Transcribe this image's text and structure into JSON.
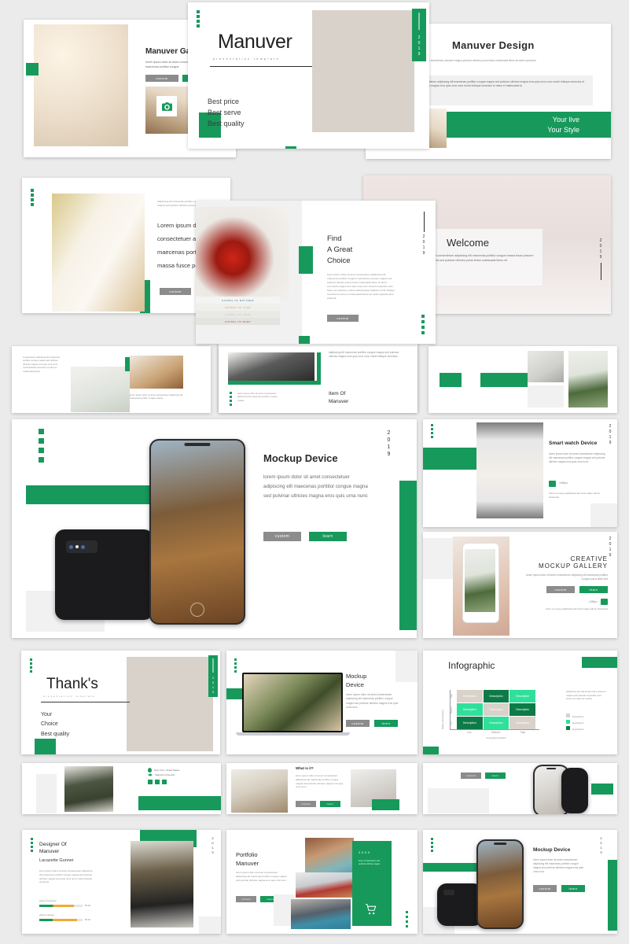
{
  "theme": {
    "accent": "#17995c",
    "accent_light": "#2fe09a",
    "accent_dark": "#0d7b47",
    "beige": "#d8d2ca",
    "gray_btn": "#8c8c8c",
    "page_bg": "#ebebeb"
  },
  "common": {
    "year": "2019",
    "year_alt": "20XX",
    "btn_custom": "custom",
    "btn_learn": "learn",
    "lorem_short": "lorem ipsum dolor sit amet consectetuer adipiscing elit maecenas porttitor congue magna",
    "lorem_med": "lorem ipsum dolor sit amet consectetuer adipiscing elit maecenas porttitor congue magna sed pulvinar ultricies magna eros quis urna nunc",
    "lorem_long": "lorem ipsum dolor sit amet consectetuer adipiscing elit maecenas porttitor congue magna sed pulvinar ultricies magna eros quis urna nunc morbi tristique senectus et netus et malesuada fames"
  },
  "slides": {
    "gallery": {
      "title": "Manuver Gallery",
      "body": "lorem ipsum dolor sit amet consectetuer adipiscing elit maecenas porttitor congue",
      "btn_custom": "custom",
      "btn_learn": "learn",
      "icon_camera": "camera-icon",
      "icon_speaker": "speaker-icon"
    },
    "cover": {
      "title": "Manuver",
      "subtitle": "presentation template",
      "bullets": [
        "Best price",
        "Best serve",
        "Best quality"
      ],
      "year": "2019"
    },
    "design": {
      "title": "Manuver  Design",
      "lead": "adipiscing elit maecenas porttitor congue maecefusce posuere magna pulvinar ultricies purus lectus malesuada libero sit amet commodo",
      "body": "lorem ipsum dolor sit amet consectetuer adipiscing elit maecenas porttitor congue magna sed pulvinar ultricies magna eros quis urna nunc morbi tristique senectus et netus et malesuada fames ultricies magna eros quis urna nunc morbi tristique senectus et netus et malesuada fa",
      "tagline_1": "Your live",
      "tagline_2": "Your Style"
    },
    "bedroom": {
      "lead": "adipiscing elit maecenas porttitor congue maecefusce posuere magna sed pulvinar ultricies purus lectus malesuada libero sit",
      "lines": [
        "Lorem ipsum d",
        "consectetuer a",
        "maecenas port",
        "massa fusce po"
      ],
      "btn_custom": "custom"
    },
    "choice": {
      "title_lines": [
        "Find",
        "A Great",
        "Choice"
      ],
      "body": "lorem ipsum dolor sit amet consectetuer adipiscing elit maecenas porttitor congue maecefusce posuere magna sed pulvinar ultricies purus lectus malesuada libero sit amet commodo magna eros quis urna nunc cinema imperdiet enim fusce est vivamus a tellus pellentesque habitant morbi tristique senectus et netus et malesuada fames ac turpis egestas pirue pharetra",
      "btn_custom": "custom",
      "year": "2019",
      "book_lines": [
        "GOSPEL OF MATTHEW",
        "GOSPEL OF LUKE",
        "GOSPEL OF JOHN",
        "GOSPEL OF MARK"
      ]
    },
    "welcome": {
      "title": "Welcome",
      "body": "lorem ipsum dolor sit amet consectetuer adipiscing elit maecenas porttitor congue massa fusce posuere magna sed pulvinar ultricies purus lectus malesuada libero sit",
      "year": "2019"
    },
    "strip_left": {
      "body": "consectetuer adipiscing elit maecenas porttitor congue magna sed pulvinar ultricies magna eros quis urna nunc morbi tristique senectus et netus et malesuada fames",
      "caption": "lorem ipsum dolor sit amet consectetuer adipiscing elit maecenas porttitor congue massa"
    },
    "strip_mid": {
      "body": "adipiscing elit maecenas porttitor congue magna sed pulvinar ultricies magna eros quis urna nunc morbi tristique senectus",
      "caption": "lorem ipsum dolor sit amet consectetuer adipiscing elit maecenas porttitor congue massa",
      "title_1": "Item Of",
      "title_2": "Manuver"
    },
    "mockup_device": {
      "title": "Mockup Device",
      "body": "lorem ipsum dolor sit amet consectetuer adipiscing elit maecenas porttitor congue magna sed pulvinar ultricies magna eros quis urna nunc",
      "btn_custom": "custom",
      "btn_learn": "learn",
      "year": "2019"
    },
    "smart_watch": {
      "title": "Smart watch Device",
      "body": "lorem ipsum dolor sit amet consectetuer adipiscing elit maecenas porttitor congue magna sed pulvinar ultricies magna eros quis urna nunc",
      "badge": "1080px",
      "note": "there is a long established fact that reader will be distracted",
      "icon": "image-icon",
      "year": "2019"
    },
    "creative_gallery": {
      "title_1": "CREATIVE",
      "title_2": "MOCKUP GALLERY",
      "body": "lorem ipsum dolor sit amet consectetuer adipiscing elit maecenas porttitor congue purus amet sed",
      "btn_custom": "custom",
      "btn_learn": "learn",
      "badge": "1080px",
      "note": "there is a long established fact that reader will be distracted",
      "icon": "image-icon",
      "year": "2019"
    },
    "thanks": {
      "title": "Thank's",
      "subtitle": "presentation template",
      "bullets": [
        "Your",
        "Choice",
        "Best quality"
      ],
      "year": "2019"
    },
    "laptop": {
      "title_1": "Mockup",
      "title_2": "Device",
      "body": "lorem ipsum dolor sit amet consectetuer adipiscing elit maecenas porttitor congue magna sed pulvinar ultricies magna eros quis urna nunc",
      "btn_custom": "custom",
      "btn_learn": "learn"
    },
    "infographic": {
      "title": "Infographic",
      "body": "adipiscing elit maecenas fusce posuere magna sed pulvinar imperdiet enim fusce est vivamus a tellus",
      "legend": [
        "Description",
        "Description",
        "Description"
      ],
      "legend_colors": [
        "#d8d2ca",
        "#2fe09a",
        "#0d7b47"
      ],
      "ylabel": "Market Attractiveness",
      "xlabel": "Competitive Position",
      "yticks": [
        "High",
        "Medium",
        "Low"
      ],
      "xticks": [
        "Low",
        "Medium",
        "High"
      ],
      "cell_label": "Description"
    },
    "profile": {
      "location": "New York, United States",
      "education": "Stanford University",
      "socials": [
        "facebook-icon",
        "twitter-icon",
        "instagram-icon"
      ]
    },
    "interior_card": {
      "title": "What is it?",
      "body": "lorem ipsum dolor sit amet consectetuer adipiscing elit maecenas porttitor congue magna sed pulvinar ultricies magna eros quis urna nunc",
      "btn_custom": "custom",
      "btn_learn": "learn"
    },
    "phone_card": {
      "btn_custom": "custom",
      "btn_learn": "learn"
    },
    "designer": {
      "title_1": "Designer Of",
      "title_2": "Manuver",
      "name": "Lacazette  Gunner",
      "body": "lorem ipsum dolor sit amet consectetuer adipiscing elit maecenas porttitor congue magna sed pulvinar ultricies magna eros quis urna nunc morbi tristique senectus",
      "skills": [
        {
          "label": "adobe photoshop",
          "value": "80.00",
          "pct": 80
        },
        {
          "label": "adobe indesign",
          "value": "88.00",
          "pct": 88
        }
      ],
      "year": "2019"
    },
    "portfolio": {
      "title_1": "Portfolio",
      "title_2": "Manuver",
      "body": "lorem ipsum dolor sit amet consectetuer adipiscing elit maecenas porttitor congue magna sed pulvinar ultricies magna eros quis urna nunc",
      "btn_custom": "custom",
      "btn_learn": "learn",
      "year_badge": "20XX",
      "badge_body": "lorem consectetuer sed pulvinar ultricies magna",
      "icon_cart": "shopping-cart-icon"
    },
    "mockup_device_2": {
      "title": "Mockup Device",
      "body": "lorem ipsum dolor sit amet consectetuer adipiscing elit maecenas porttitor congue magna sed pulvinar ultricies magna eros quis urna nunc",
      "btn_custom": "custom",
      "btn_learn": "learn",
      "year": "2019"
    }
  }
}
